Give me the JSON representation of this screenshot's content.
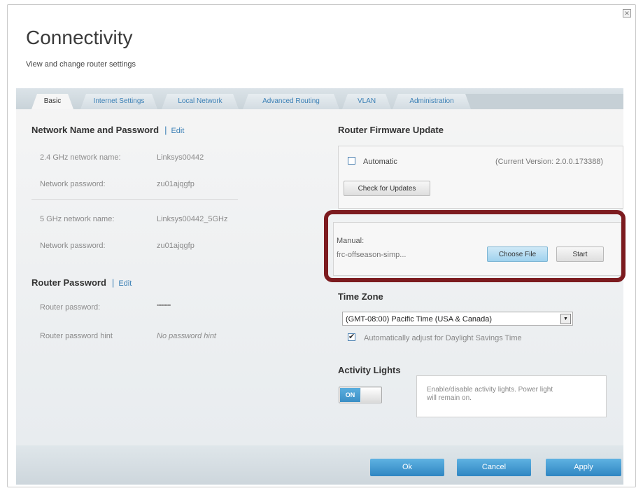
{
  "header": {
    "title": "Connectivity",
    "subtitle": "View and change router settings"
  },
  "tabs": [
    {
      "label": "Basic",
      "active": true
    },
    {
      "label": "Internet Settings",
      "active": false
    },
    {
      "label": "Local Network",
      "active": false
    },
    {
      "label": "Advanced Routing",
      "active": false
    },
    {
      "label": "VLAN",
      "active": false
    },
    {
      "label": "Administration",
      "active": false
    }
  ],
  "network": {
    "title": "Network Name and Password",
    "separator": "|",
    "edit": "Edit",
    "rows": [
      {
        "label": "2.4 GHz network name:",
        "value": "Linksys00442"
      },
      {
        "label": "Network password:",
        "value": "zu01ajqgfp"
      },
      {
        "label": "5 GHz network name:",
        "value": "Linksys00442_5GHz"
      },
      {
        "label": "Network password:",
        "value": "zu01ajqgfp"
      }
    ]
  },
  "router_password": {
    "title": "Router Password",
    "separator": "|",
    "edit": "Edit",
    "rows": [
      {
        "label": "Router password:",
        "value": "•••••••••"
      },
      {
        "label": "Router password hint",
        "value": "No password hint"
      }
    ]
  },
  "firmware": {
    "title": "Router Firmware Update",
    "automatic_label": "Automatic",
    "automatic_checked": false,
    "current_version": "(Current Version: 2.0.0.173388)",
    "check_button": "Check for Updates",
    "manual_label": "Manual:",
    "manual_file": "frc-offseason-simp...",
    "choose_file_button": "Choose File",
    "start_button": "Start"
  },
  "timezone": {
    "title": "Time Zone",
    "selected": "(GMT-08:00) Pacific Time (USA & Canada)",
    "dst_label": "Automatically adjust for Daylight Savings Time",
    "dst_checked": true
  },
  "activity": {
    "title": "Activity Lights",
    "toggle_label": "ON",
    "info_line1": "Enable/disable activity lights. Power light",
    "info_line2": "will remain on."
  },
  "footer": {
    "ok": "Ok",
    "cancel": "Cancel",
    "apply": "Apply"
  },
  "colors": {
    "accent": "#3a7fb5",
    "button_blue": "#3b8fc6",
    "highlight_border": "#7c1b1f"
  }
}
